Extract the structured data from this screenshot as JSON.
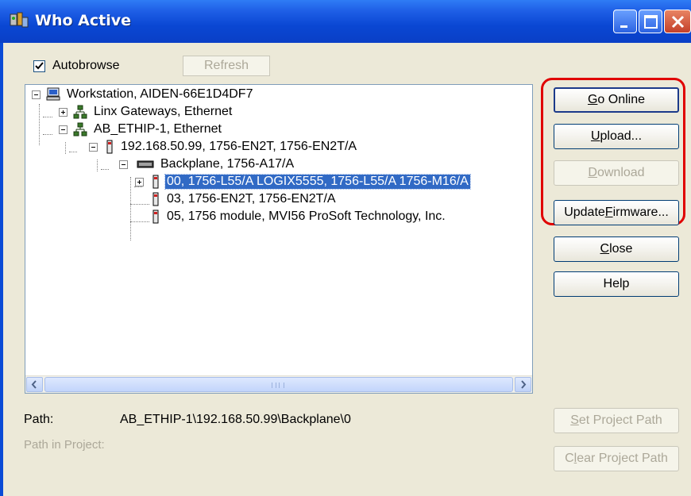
{
  "window": {
    "title": "Who Active"
  },
  "autobrowse": {
    "label": "Autobrowse",
    "checked": true
  },
  "refresh_label": "Refresh",
  "tree": [
    {
      "label": "Workstation, AIDEN-66E1D4DF7",
      "icon": "computer-icon",
      "expanded": true
    },
    {
      "label": "Linx Gateways, Ethernet",
      "icon": "network-icon",
      "expanded": false
    },
    {
      "label": "AB_ETHIP-1, Ethernet",
      "icon": "network-icon",
      "expanded": true
    },
    {
      "label": "192.168.50.99, 1756-EN2T, 1756-EN2T/A",
      "icon": "module-icon",
      "expanded": true
    },
    {
      "label": "Backplane, 1756-A17/A",
      "icon": "backplane-icon",
      "expanded": true
    },
    {
      "label": "00, 1756-L55/A LOGIX5555, 1756-L55/A 1756-M16/A",
      "icon": "module-icon",
      "expanded": false,
      "selected": true
    },
    {
      "label": "03, 1756-EN2T, 1756-EN2T/A",
      "icon": "module-icon"
    },
    {
      "label": "05, 1756 module, MVI56 ProSoft Technology, Inc.",
      "icon": "module-icon"
    }
  ],
  "buttons": {
    "go_online": {
      "pre": "",
      "key": "G",
      "post": "o Online"
    },
    "upload": {
      "pre": "",
      "key": "U",
      "post": "pload..."
    },
    "download": {
      "pre": "",
      "key": "D",
      "post": "ownload"
    },
    "update_firmware": {
      "pre": "Update ",
      "key": "F",
      "post": "irmware..."
    },
    "close": {
      "pre": "",
      "key": "C",
      "post": "lose"
    },
    "help": "Help",
    "set_project_path": {
      "pre": "",
      "key": "S",
      "post": "et Project Path"
    },
    "clear_project_path": {
      "pre": "C",
      "key": "l",
      "post": "ear Project Path"
    }
  },
  "path": {
    "label": "Path:",
    "value": "AB_ETHIP-1\\192.168.50.99\\Backplane\\0"
  },
  "path_in_project": {
    "label": "Path in Project:"
  },
  "colors": {
    "title_bar": "#0a4bd6",
    "selection": "#316ac5",
    "highlight_outline": "#e00000"
  }
}
